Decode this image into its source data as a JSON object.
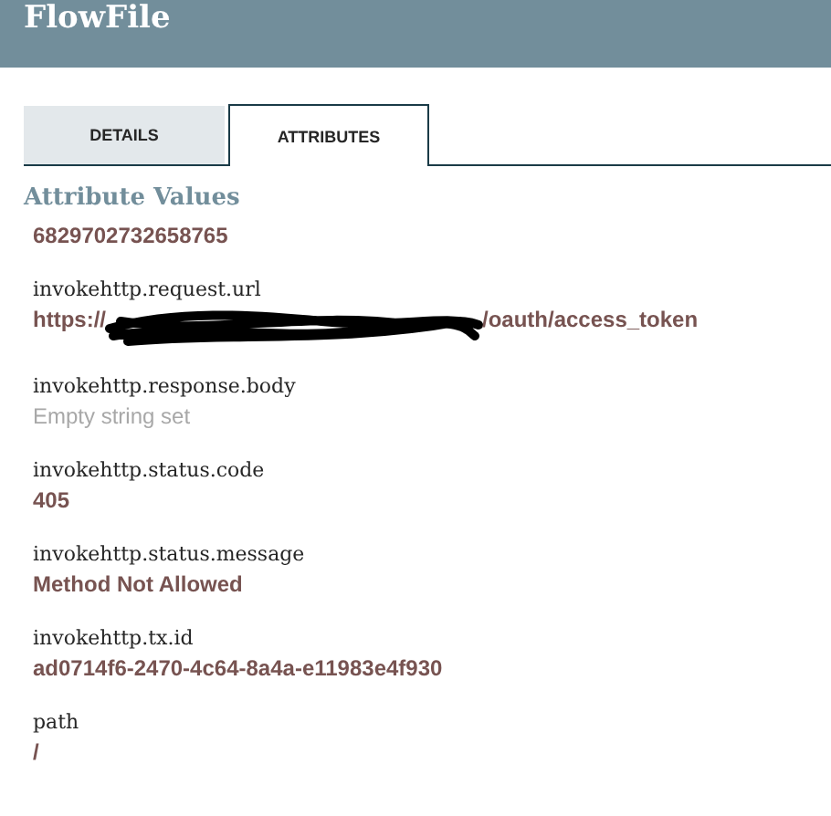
{
  "header": {
    "title": "FlowFile"
  },
  "tabs": [
    {
      "label": "DETAILS",
      "selected": false
    },
    {
      "label": "ATTRIBUTES",
      "selected": true
    }
  ],
  "section_title": "Attribute Values",
  "attributes": [
    {
      "kind": "value",
      "value": "6829702732658765"
    },
    {
      "kind": "redacted",
      "name": "invokehttp.request.url",
      "value_start": "https://",
      "value_end": "/oauth/access_token"
    },
    {
      "kind": "empty",
      "name": "invokehttp.response.body",
      "value": "Empty string set"
    },
    {
      "kind": "value",
      "name": "invokehttp.status.code",
      "value": "405"
    },
    {
      "kind": "value",
      "name": "invokehttp.status.message",
      "value": "Method Not Allowed"
    },
    {
      "kind": "value",
      "name": "invokehttp.tx.id",
      "value": "ad0714f6-2470-4c64-8a4a-e11983e4f930"
    },
    {
      "kind": "value",
      "name": "path",
      "value": "/"
    }
  ]
}
